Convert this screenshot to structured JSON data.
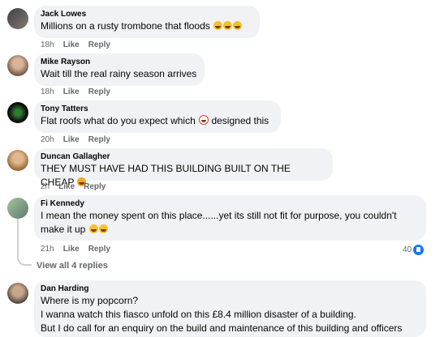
{
  "comments": [
    {
      "author": "Jack Lowes",
      "text": "Millions on a rusty trombone that floods",
      "time": "18h",
      "like": "Like",
      "reply": "Reply"
    },
    {
      "author": "Mike Rayson",
      "text": "Wait till the real rainy season arrives",
      "time": "18h",
      "like": "Like",
      "reply": "Reply"
    },
    {
      "author": "Tony Tatters",
      "text_before": "Flat roofs what do you expect which",
      "text_after": "designed this",
      "time": "20h",
      "like": "Like",
      "reply": "Reply"
    },
    {
      "author": "Duncan Gallagher",
      "text": "THEY MUST HAVE HAD THIS BUILDING BUILT ON THE CHEAP",
      "time": "2h",
      "like": "Like",
      "reply": "Reply"
    },
    {
      "author": "Fi Kennedy",
      "line1": "I mean the money spent on this place......yet its still not fit for purpose, you couldn't",
      "line2": "make it up",
      "time": "21h",
      "like": "Like",
      "reply": "Reply",
      "reaction_count": "40"
    },
    {
      "author": "Dan Harding",
      "line1": "Where is my popcorn?",
      "line2": "I wanna watch this fiasco unfold on this £8.4 million disaster of a building.",
      "line3": "But I do call for an enquiry on the build and maintenance of this building and officers"
    }
  ],
  "view_replies": "View all 4 replies",
  "colors": {
    "bubble": "#f0f2f5",
    "meta": "#65676b",
    "like_blue": "#1877f2"
  }
}
